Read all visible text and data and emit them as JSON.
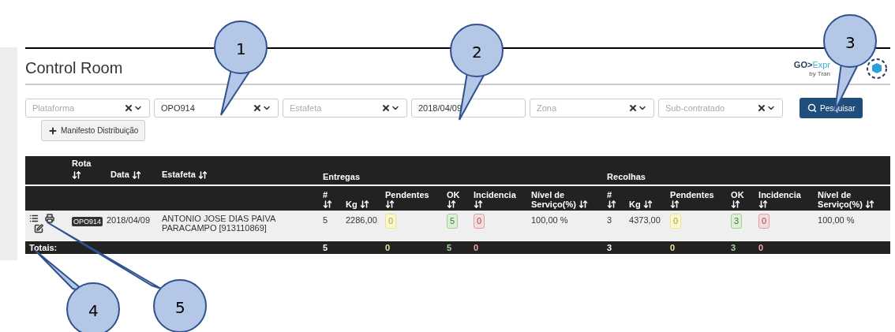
{
  "title": "Control Room",
  "logo": {
    "brand": "GO>",
    "brand_rest": "Expr",
    "byline": "by Tran"
  },
  "filters": [
    {
      "kind": "select",
      "placeholder": "Plataforma"
    },
    {
      "kind": "select",
      "value": "OPO914"
    },
    {
      "kind": "select",
      "placeholder": "Estafeta"
    },
    {
      "kind": "date",
      "value": "2018/04/09"
    },
    {
      "kind": "select",
      "placeholder": "Zona"
    },
    {
      "kind": "select",
      "placeholder": "Sub-contratado"
    }
  ],
  "search_button": "Pesquisar",
  "manifest_button": "Manifesto Distribuição",
  "table": {
    "top_columns": [
      "Rota",
      "Data",
      "Estafeta"
    ],
    "groups": [
      "Entregas",
      "Recolhas"
    ],
    "sub_columns": [
      [
        "#",
        "Kg",
        "Pendentes",
        "OK",
        "Incidencia",
        "Nível de Serviço(%)"
      ],
      [
        "#",
        "Kg",
        "Pendentes",
        "OK",
        "Incidencia",
        "Nível de Serviço(%)"
      ]
    ],
    "rows": [
      {
        "route": "OPO914",
        "date": "2018/04/09",
        "courier": "ANTONIO JOSE DIAS PAIVA PARACAMPO [913110869]",
        "cells": [
          {
            "kind": "plain",
            "text": "5"
          },
          {
            "kind": "plain",
            "text": "2286,00"
          },
          {
            "kind": "pending",
            "text": "0"
          },
          {
            "kind": "ok",
            "text": "5"
          },
          {
            "kind": "incident",
            "text": "0"
          },
          {
            "kind": "plain",
            "text": "100,00 %"
          },
          {
            "kind": "plain",
            "text": "3"
          },
          {
            "kind": "plain",
            "text": "4373,00"
          },
          {
            "kind": "pending",
            "text": "0"
          },
          {
            "kind": "ok",
            "text": "3"
          },
          {
            "kind": "incident",
            "text": "0"
          },
          {
            "kind": "plain",
            "text": "100,00 %"
          }
        ]
      }
    ],
    "totals": {
      "label": "Totais:",
      "cells": [
        {
          "kind": "plain",
          "text": "5"
        },
        {
          "kind": "plain"
        },
        {
          "kind": "pending",
          "text": "0"
        },
        {
          "kind": "ok",
          "text": "5"
        },
        {
          "kind": "incident",
          "text": "0"
        },
        {
          "kind": "plain"
        },
        {
          "kind": "plain",
          "text": "3"
        },
        {
          "kind": "plain"
        },
        {
          "kind": "pending",
          "text": "0"
        },
        {
          "kind": "ok",
          "text": "3"
        },
        {
          "kind": "incident",
          "text": "0"
        },
        {
          "kind": "plain"
        }
      ]
    }
  },
  "callouts": [
    "1",
    "2",
    "3",
    "4",
    "5"
  ]
}
